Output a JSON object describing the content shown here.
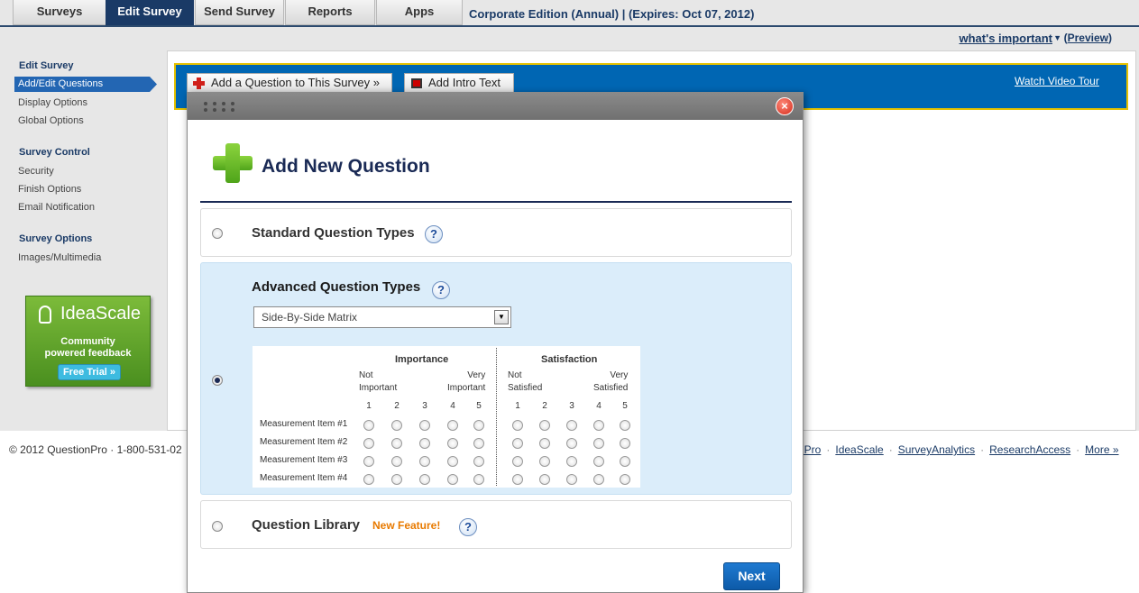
{
  "topnav": {
    "tabs": [
      {
        "label": "Surveys"
      },
      {
        "label": "Edit Survey"
      },
      {
        "label": "Send Survey"
      },
      {
        "label": "Reports"
      },
      {
        "label": "Apps"
      }
    ],
    "edition": "Corporate Edition (Annual) | (Expires: Oct 07, 2012)"
  },
  "subbar": {
    "whats_important": "what's important",
    "preview": "Preview"
  },
  "sidebar": {
    "sections": [
      {
        "heading": "Edit Survey",
        "items": [
          "Add/Edit Questions",
          "Display Options",
          "Global Options"
        ]
      },
      {
        "heading": "Survey Control",
        "items": [
          "Security",
          "Finish Options",
          "Email Notification"
        ]
      },
      {
        "heading": "Survey Options",
        "items": [
          "Images/Multimedia"
        ]
      }
    ],
    "ad": {
      "brand": "IdeaScale",
      "line1": "Community",
      "line2": "powered feedback",
      "button": "Free Trial »"
    }
  },
  "toolbar": {
    "add_question": "Add a Question to This Survey »",
    "add_intro": "Add Intro Text",
    "video_tour": "Watch Video Tour"
  },
  "footer": {
    "left": "© 2012 QuestionPro · 1-800-531-02",
    "links": [
      "nPro",
      "IdeaScale",
      "SurveyAnalytics",
      "ResearchAccess",
      "More »"
    ]
  },
  "modal": {
    "title": "Add New Question",
    "options": {
      "standard": "Standard Question Types",
      "advanced": "Advanced Question Types",
      "library": "Question Library",
      "new_feature": "New Feature!"
    },
    "help_glyph": "?",
    "close_glyph": "×",
    "select_value": "Side-By-Side Matrix",
    "matrix": {
      "group1": "Importance",
      "group2": "Satisfaction",
      "g1_low1": "Not",
      "g1_low2": "Important",
      "g1_high1": "Very",
      "g1_high2": "Important",
      "g2_low1": "Not",
      "g2_low2": "Satisfied",
      "g2_high1": "Very",
      "g2_high2": "Satisfied",
      "scale": [
        "1",
        "2",
        "3",
        "4",
        "5"
      ],
      "rows": [
        "Measurement Item #1",
        "Measurement Item #2",
        "Measurement Item #3",
        "Measurement Item #4"
      ]
    },
    "next": "Next"
  },
  "colors": {
    "navy": "#1a3a66",
    "brand_blue": "#0066b3",
    "accent_orange": "#e87a00",
    "selected_panel": "#dbedfa"
  }
}
